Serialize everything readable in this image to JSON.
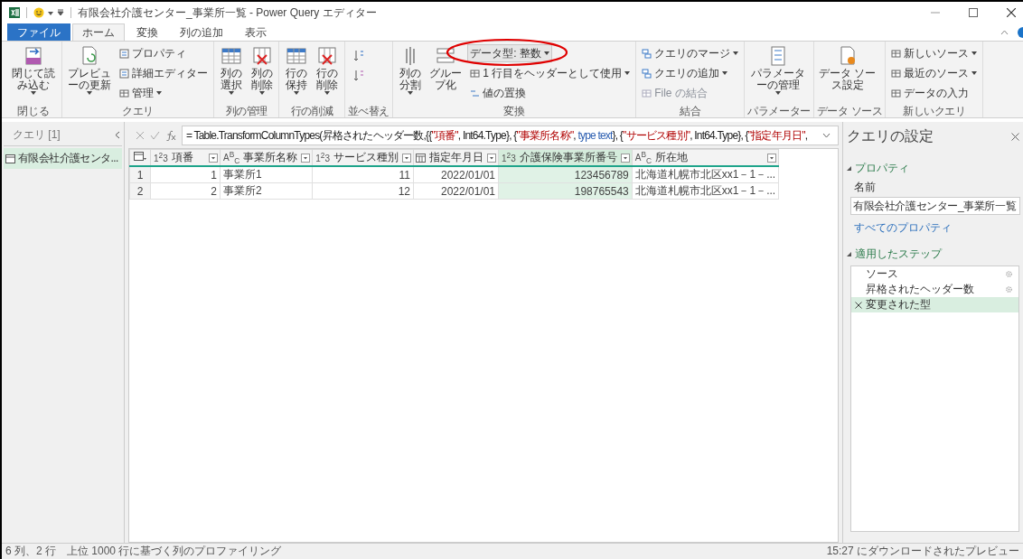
{
  "window": {
    "title": "有限会社介護センター_事業所一覧 - Power Query エディター"
  },
  "tabs": [
    {
      "label": "ファイル",
      "kind": "file",
      "selected": false
    },
    {
      "label": "ホーム",
      "kind": "tab",
      "selected": true
    },
    {
      "label": "変換",
      "kind": "tab",
      "selected": false
    },
    {
      "label": "列の追加",
      "kind": "tab",
      "selected": false
    },
    {
      "label": "表示",
      "kind": "tab",
      "selected": false
    }
  ],
  "ribbon": [
    {
      "label": "閉じる",
      "items": [
        {
          "kind": "large",
          "label": "閉じて読み込む",
          "dropdown": true
        }
      ]
    },
    {
      "label": "クエリ",
      "items": [
        {
          "kind": "large",
          "label": "プレビューの更新",
          "dropdown": true
        },
        {
          "kind": "small",
          "label": "プロパティ",
          "dropdown": false
        },
        {
          "kind": "small",
          "label": "詳細エディター",
          "dropdown": false
        },
        {
          "kind": "small",
          "label": "管理",
          "dropdown": true
        }
      ]
    },
    {
      "label": "列の管理",
      "items": [
        {
          "kind": "large",
          "label": "列の選択",
          "dropdown": true
        },
        {
          "kind": "large",
          "label": "列の削除",
          "dropdown": true
        }
      ]
    },
    {
      "label": "行の削減",
      "items": [
        {
          "kind": "large",
          "label": "行の保持",
          "dropdown": true
        },
        {
          "kind": "large",
          "label": "行の削除",
          "dropdown": true
        }
      ]
    },
    {
      "label": "並べ替え",
      "items": [
        {
          "kind": "icon"
        },
        {
          "kind": "icon"
        }
      ]
    },
    {
      "label": "変換",
      "items": [
        {
          "kind": "large",
          "label": "列の分割",
          "dropdown": true,
          "highlighted": false
        },
        {
          "kind": "large",
          "label": "グループ化",
          "dropdown": false,
          "highlighted": false
        },
        {
          "kind": "small",
          "label": "データ型: 整数",
          "dropdown": true,
          "highlighted": true
        },
        {
          "kind": "small",
          "label": "1 行目をヘッダーとして使用",
          "dropdown": true,
          "highlighted": false
        },
        {
          "kind": "small",
          "label": "値の置換",
          "dropdown": false,
          "highlighted": false
        }
      ]
    },
    {
      "label": "結合",
      "items": [
        {
          "kind": "small",
          "label": "クエリのマージ",
          "dropdown": true,
          "disabled": false
        },
        {
          "kind": "small",
          "label": "クエリの追加",
          "dropdown": true,
          "disabled": false
        },
        {
          "kind": "small",
          "label": "File の結合",
          "dropdown": false,
          "disabled": true
        }
      ]
    },
    {
      "label": "パラメーター",
      "items": [
        {
          "kind": "large",
          "label": "パラメーターの管理",
          "dropdown": true
        }
      ]
    },
    {
      "label": "データ ソース",
      "items": [
        {
          "kind": "large",
          "label": "データ ソース設定",
          "dropdown": false
        }
      ]
    },
    {
      "label": "新しいクエリ",
      "items": [
        {
          "kind": "small",
          "label": "新しいソース",
          "dropdown": true
        },
        {
          "kind": "small",
          "label": "最近のソース",
          "dropdown": true
        },
        {
          "kind": "small",
          "label": "データの入力",
          "dropdown": false
        }
      ]
    }
  ],
  "queries": {
    "title": "クエリ [1]",
    "items": [
      {
        "label": "有限会社介護センタ...",
        "selected": true
      }
    ]
  },
  "formula": {
    "tokens": [
      {
        "kind": "code",
        "text": "= Table.TransformColumnTypes(昇格されたヘッダー数,{{"
      },
      {
        "kind": "string",
        "text": "\"項番\""
      },
      {
        "kind": "code",
        "text": ", Int64.Type}, {"
      },
      {
        "kind": "string",
        "text": "\"事業所名称\""
      },
      {
        "kind": "code",
        "text": ", "
      },
      {
        "kind": "keyword",
        "text": "type text"
      },
      {
        "kind": "code",
        "text": "}, {"
      },
      {
        "kind": "string",
        "text": "\"サービス種別\""
      },
      {
        "kind": "code",
        "text": ", Int64.Type}, {"
      },
      {
        "kind": "string",
        "text": "\"指定年月日\""
      },
      {
        "kind": "code",
        "text": ","
      }
    ]
  },
  "table": {
    "columns": [
      {
        "name": "項番",
        "kind": "number",
        "type_label": "1$^{2}$3",
        "selected": false
      },
      {
        "name": "事業所名称",
        "kind": "text",
        "type_label": "A$^{B}$$_{C}$",
        "selected": false
      },
      {
        "name": "サービス種別",
        "kind": "number",
        "type_label": "1$^{2}$3",
        "selected": false
      },
      {
        "name": "指定年月日",
        "kind": "date",
        "selected": false
      },
      {
        "name": "介護保険事業所番号",
        "kind": "number",
        "type_label": "1$^{2}$3",
        "selected": true
      },
      {
        "name": "所在地",
        "kind": "text",
        "type_label": "A$^{B}$$_{C}$",
        "selected": false
      }
    ],
    "rows": [
      {
        "index": "1",
        "cells": [
          "1",
          "事業所1",
          "11",
          "2022/01/01",
          "123456789",
          "北海道札幌市北区xx1－1－..."
        ]
      },
      {
        "index": "2",
        "cells": [
          "2",
          "事業所2",
          "12",
          "2022/01/01",
          "198765543",
          "北海道札幌市北区xx1－1－..."
        ]
      }
    ]
  },
  "settings": {
    "title": "クエリの設定",
    "properties_heading": "プロパティ",
    "name_label": "名前",
    "name_value": "有限会社介護センター_事業所一覧",
    "all_properties": "すべてのプロパティ",
    "steps_heading": "適用したステップ",
    "steps": [
      {
        "label": "ソース",
        "has_settings": true,
        "selected": false
      },
      {
        "label": "昇格されたヘッダー数",
        "has_settings": true,
        "selected": false
      },
      {
        "label": "変更された型",
        "has_settings": false,
        "selected": true
      }
    ]
  },
  "status_bar": {
    "left": [
      "6 列、2 行",
      "上位 1000 行に基づく列のプロファイリング"
    ],
    "right": "15:27 にダウンロードされたプレビュー"
  }
}
